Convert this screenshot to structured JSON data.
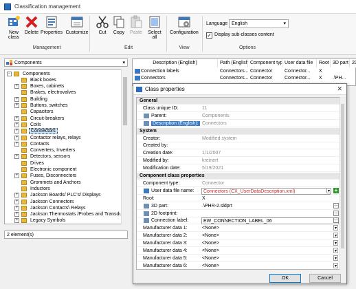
{
  "window": {
    "title": "Classification management"
  },
  "ribbon": {
    "buttons": {
      "new_class": "New class",
      "delete": "Delete",
      "properties": "Properties",
      "customize": "Customize",
      "cut": "Cut",
      "copy": "Copy",
      "paste": "Paste",
      "select_all": "Select all",
      "configuration": "Configuration"
    },
    "groups": {
      "management": "Management",
      "edit": "Edit",
      "view": "View",
      "options": "Options"
    },
    "language_label": "Language",
    "language_value": "English",
    "display_subclasses": "Display sub-classes content"
  },
  "left": {
    "combo_value": "Components",
    "tree": [
      {
        "label": "Components",
        "level": 0,
        "expander": "minus"
      },
      {
        "label": "Black boxes",
        "level": 1,
        "expander": "none"
      },
      {
        "label": "Boxes, cabinets",
        "level": 1,
        "expander": "plus"
      },
      {
        "label": "Brakes, electrovalves",
        "level": 1,
        "expander": "none"
      },
      {
        "label": "Building",
        "level": 1,
        "expander": "plus"
      },
      {
        "label": "Buttons, switches",
        "level": 1,
        "expander": "plus"
      },
      {
        "label": "Capacitors",
        "level": 1,
        "expander": "none"
      },
      {
        "label": "Circuit-breakers",
        "level": 1,
        "expander": "plus"
      },
      {
        "label": "Coils",
        "level": 1,
        "expander": "plus"
      },
      {
        "label": "Connectors",
        "level": 1,
        "expander": "plus",
        "selected": true
      },
      {
        "label": "Contactor relays, relays",
        "level": 1,
        "expander": "plus"
      },
      {
        "label": "Contacts",
        "level": 1,
        "expander": "plus"
      },
      {
        "label": "Converters, Inverters",
        "level": 1,
        "expander": "none"
      },
      {
        "label": "Detectors, sensors",
        "level": 1,
        "expander": "plus"
      },
      {
        "label": "Drives",
        "level": 1,
        "expander": "none"
      },
      {
        "label": "Electronic component",
        "level": 1,
        "expander": "none"
      },
      {
        "label": "Fuses, Disconnectors",
        "level": 1,
        "expander": "plus"
      },
      {
        "label": "Grommets and Anchors",
        "level": 1,
        "expander": "none"
      },
      {
        "label": "Inductors",
        "level": 1,
        "expander": "none"
      },
      {
        "label": "Jackson Boards/ PLC's/ Displays",
        "level": 1,
        "expander": "plus"
      },
      {
        "label": "Jackson Connectors",
        "level": 1,
        "expander": "plus"
      },
      {
        "label": "Jackson Contacts\\ Relays",
        "level": 1,
        "expander": "plus"
      },
      {
        "label": "Jackson Thermostats /Probes and Transducers",
        "level": 1,
        "expander": "plus"
      },
      {
        "label": "Legacy Symbols",
        "level": 1,
        "expander": "plus"
      }
    ],
    "status": "2 element(s)"
  },
  "grid": {
    "headers": [
      "Description (English)",
      "Path (English)",
      "Component type",
      "User data file",
      "Root",
      "3D part",
      "2D"
    ],
    "rows": [
      [
        "Connection labels",
        "Connectors...",
        "Connector",
        "Connector...",
        "X",
        "",
        ""
      ],
      [
        "Connectors",
        "Connectors...",
        "Connector",
        "Connector...",
        "X",
        ".\\PH...",
        ""
      ]
    ]
  },
  "dialog": {
    "title": "Class properties",
    "rows": [
      {
        "type": "cat",
        "key": "General"
      },
      {
        "key": "Class unique ID:",
        "value": "11",
        "gray": true
      },
      {
        "key": "Parent:",
        "value": "Components",
        "gray": true,
        "icon": true
      },
      {
        "key": "Description (English):",
        "value": "Connectors",
        "gray": true,
        "icon": true,
        "selected": true
      },
      {
        "type": "cat",
        "key": "System"
      },
      {
        "key": "Creator:",
        "value": "Modified system",
        "gray": true
      },
      {
        "key": "Created by:",
        "value": "",
        "gray": true
      },
      {
        "key": "Creation date:",
        "value": "1/1/2007",
        "gray": true
      },
      {
        "key": "Modified by:",
        "value": "kreinert",
        "gray": true
      },
      {
        "key": "Modification date:",
        "value": "5/19/2021",
        "gray": true
      },
      {
        "type": "cat",
        "key": "Component class properties"
      },
      {
        "key": "Component type:",
        "value": "Connector",
        "gray": true
      },
      {
        "key": "User data file name:",
        "value": "Connectors (CX_UserDataDescription.xml)",
        "editable": true,
        "dropdown": true,
        "icon": true,
        "red": true
      },
      {
        "key": "Root:",
        "value": "X"
      },
      {
        "key": "3D part:",
        "value": ".\\PHR-2.sldprt",
        "ellipsis": true,
        "icon": true
      },
      {
        "key": "2D footprint:",
        "value": "",
        "ellipsis": true,
        "icon": true
      },
      {
        "key": "Connection label:",
        "value": "EW_CONNECTION_LABEL_06",
        "ellipsis": true,
        "icon": true,
        "boxed": true
      },
      {
        "key": "Manufacturer data 1:",
        "value": "<None>",
        "dropdown": true
      },
      {
        "key": "Manufacturer data 2:",
        "value": "<None>",
        "dropdown": true
      },
      {
        "key": "Manufacturer data 3:",
        "value": "<None>",
        "dropdown": true
      },
      {
        "key": "Manufacturer data 4:",
        "value": "<None>",
        "dropdown": true
      },
      {
        "key": "Manufacturer data 5:",
        "value": "<None>",
        "dropdown": true
      },
      {
        "key": "Manufacturer data 6:",
        "value": "<None>",
        "dropdown": true
      }
    ],
    "ok_label": "OK",
    "cancel_label": "Cancel"
  }
}
